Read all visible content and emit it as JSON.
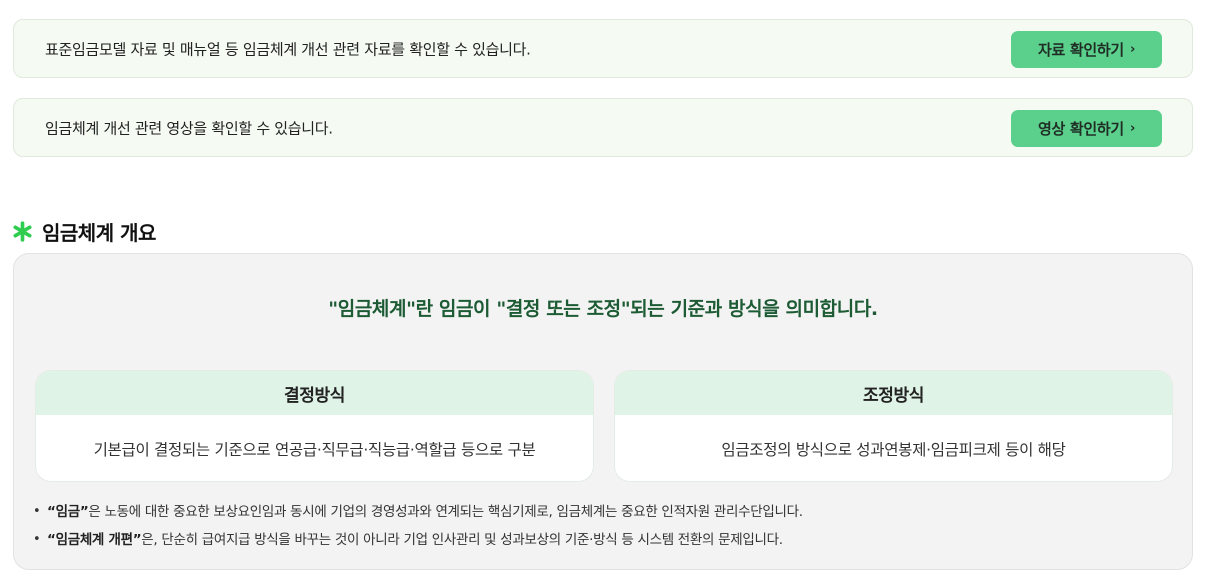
{
  "notices": [
    {
      "text": "표준임금모델 자료 및 매뉴얼 등 임금체계 개선 관련 자료를 확인할 수 있습니다.",
      "button_label": "자료 확인하기",
      "button_chevron": "›"
    },
    {
      "text": "임금체계 개선 관련 영상을 확인할 수 있습니다.",
      "button_label": "영상 확인하기",
      "button_chevron": "›"
    }
  ],
  "section": {
    "icon": "asterisk-icon",
    "title": "임금체계 개요"
  },
  "overview": {
    "headline": "\"임금체계\"란 임금이 \"결정 또는 조정\"되는 기준과 방식을 의미합니다.",
    "cards": [
      {
        "title": "결정방식",
        "body": "기본급이 결정되는 기준으로 연공급·직무급·직능급·역할급 등으로 구분"
      },
      {
        "title": "조정방식",
        "body": "임금조정의 방식으로 성과연봉제·임금피크제 등이 해당"
      }
    ],
    "bullets": [
      {
        "bullet": "•",
        "term": "“임금”",
        "rest": "은 노동에 대한 중요한 보상요인임과 동시에 기업의 경영성과와 연계되는 핵심기제로, 임금체계는 중요한 인적자원 관리수단입니다."
      },
      {
        "bullet": "•",
        "term": "“임금체계 개편”",
        "rest": "은, 단순히 급여지급 방식을 바꾸는 것이 아니라 기업 인사관리 및 성과보상의 기준·방식 등 시스템 전환의 문제입니다."
      }
    ]
  },
  "colors": {
    "accent_green": "#5bd08c",
    "headline_green": "#1d5b34",
    "asterisk_green": "#2ecc4f",
    "card_header_bg": "#dff3e6",
    "notice_bg": "#f5faf3",
    "overview_bg": "#f3f3f3"
  }
}
